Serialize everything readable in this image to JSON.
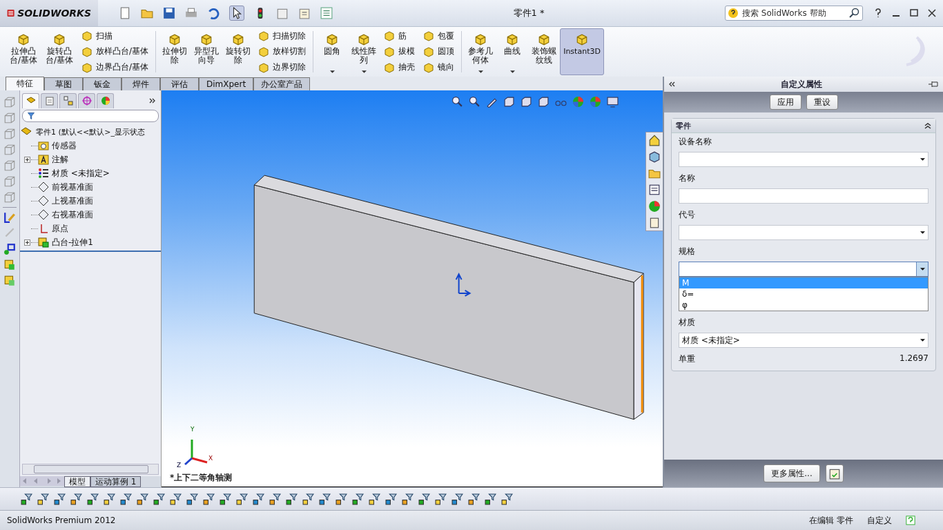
{
  "app": {
    "logo": "SOLIDWORKS",
    "title": "零件1 *",
    "search_placeholder": "搜索 SolidWorks 帮助"
  },
  "ribbon": [
    {
      "kind": "large",
      "label": "拉伸凸台/基体",
      "on": false
    },
    {
      "kind": "large",
      "label": "旋转凸台/基体",
      "on": false
    },
    {
      "kind": "stack",
      "items": [
        "扫描",
        "放样凸台/基体",
        "边界凸台/基体"
      ]
    },
    {
      "kind": "separator"
    },
    {
      "kind": "large",
      "label": "拉伸切除",
      "on": false
    },
    {
      "kind": "large",
      "label": "异型孔向导",
      "on": false
    },
    {
      "kind": "large",
      "label": "旋转切除",
      "on": false
    },
    {
      "kind": "stack",
      "items": [
        "扫描切除",
        "放样切割",
        "边界切除"
      ]
    },
    {
      "kind": "separator"
    },
    {
      "kind": "large",
      "label": "圆角",
      "on": false,
      "dropdown": true
    },
    {
      "kind": "large",
      "label": "线性阵列",
      "on": false,
      "dropdown": true
    },
    {
      "kind": "stack",
      "items": [
        "筋",
        "拔模",
        "抽壳"
      ]
    },
    {
      "kind": "stack",
      "items": [
        "包覆",
        "圆顶",
        "镜向"
      ]
    },
    {
      "kind": "separator"
    },
    {
      "kind": "large",
      "label": "参考几何体",
      "on": false,
      "dropdown": true
    },
    {
      "kind": "large",
      "label": "曲线",
      "on": false,
      "dropdown": true
    },
    {
      "kind": "large",
      "label": "装饰螺纹线",
      "on": false
    },
    {
      "kind": "large",
      "label": "Instant3D",
      "on": true
    }
  ],
  "tabs": [
    {
      "label": "特征",
      "selected": true
    },
    {
      "label": "草图",
      "selected": false
    },
    {
      "label": "钣金",
      "selected": false
    },
    {
      "label": "焊件",
      "selected": false
    },
    {
      "label": "评估",
      "selected": false
    },
    {
      "label": "DimXpert",
      "selected": false
    },
    {
      "label": "办公室产品",
      "selected": false
    }
  ],
  "manager_tabs": [
    {
      "kind": "feature",
      "selected": true
    },
    {
      "kind": "property",
      "selected": false
    },
    {
      "kind": "config",
      "selected": false
    },
    {
      "kind": "dimxpert",
      "selected": false
    },
    {
      "kind": "display",
      "selected": false
    }
  ],
  "tree": {
    "label": "零件1 (默认<<默认>_显示状态",
    "children": [
      {
        "label": "传感器",
        "kind": "sensor",
        "collapsed": false
      },
      {
        "label": "注解",
        "kind": "annotation",
        "collapsed": true
      },
      {
        "label": "材质 <未指定>",
        "kind": "material",
        "collapsed": false
      },
      {
        "label": "前视基准面",
        "kind": "plane",
        "collapsed": false
      },
      {
        "label": "上视基准面",
        "kind": "plane",
        "collapsed": false
      },
      {
        "label": "右视基准面",
        "kind": "plane",
        "collapsed": false
      },
      {
        "label": "原点",
        "kind": "origin",
        "collapsed": false
      },
      {
        "label": "凸台-拉伸1",
        "kind": "feature",
        "collapsed": true
      }
    ]
  },
  "bottom_tabs": [
    {
      "label": "模型",
      "selected": true
    },
    {
      "label": "运动算例 1",
      "selected": false
    }
  ],
  "viewport": {
    "view_name": "*上下二等角轴测",
    "axes": [
      "Y",
      "X",
      "Z"
    ]
  },
  "panel": {
    "title": "自定义属性",
    "buttons": [
      "应用",
      "重设"
    ],
    "section": "零件",
    "fields": [
      {
        "kind": "combo",
        "label": "设备名称",
        "open": false
      },
      {
        "kind": "text",
        "label": "名称"
      },
      {
        "kind": "combo",
        "label": "代号",
        "open": false
      },
      {
        "kind": "combo",
        "label": "规格",
        "open": true,
        "options": [
          {
            "label": "M",
            "selected": true
          },
          {
            "label": "δ=",
            "selected": false
          },
          {
            "label": "φ",
            "selected": false
          }
        ]
      },
      {
        "kind": "combo",
        "label": "材质",
        "value": "材质 <未指定>",
        "open": false
      },
      {
        "kind": "readout",
        "label": "单重",
        "value": "1.2697"
      }
    ],
    "more_button": "更多属性..."
  },
  "status_bar": {
    "product": "SolidWorks Premium 2012",
    "mode": "在编辑 零件",
    "units": "自定义"
  }
}
